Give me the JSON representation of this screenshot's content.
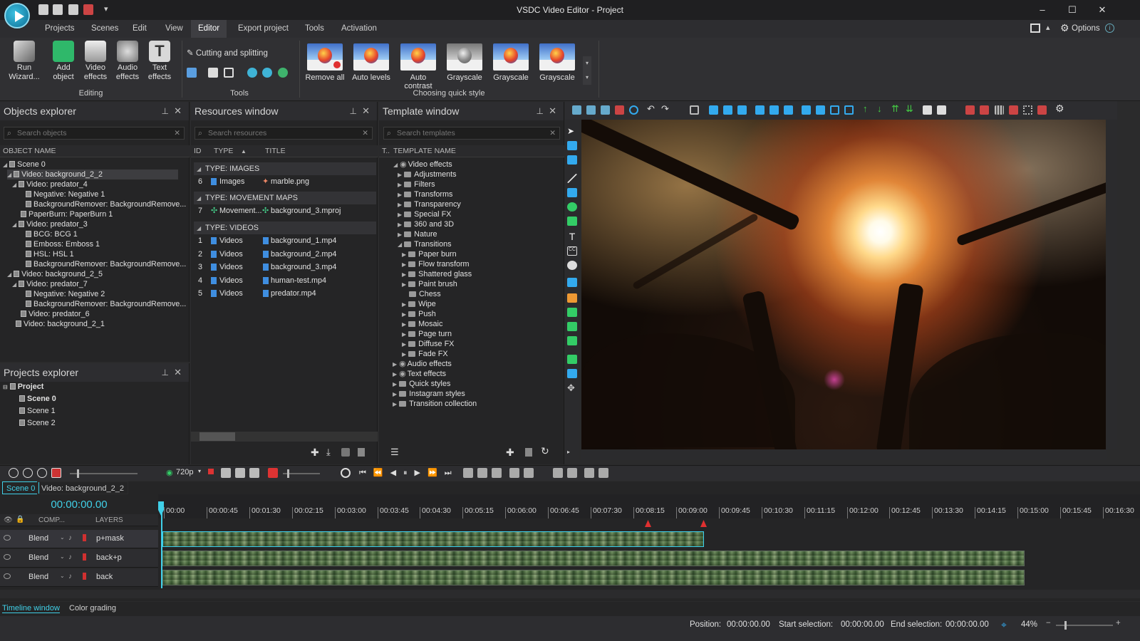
{
  "window": {
    "title": "VSDC Video Editor - Project",
    "options_label": "Options",
    "minimize": "–",
    "maximize": "☐",
    "close": "✕"
  },
  "menu": [
    "Projects",
    "Scenes",
    "Edit",
    "View",
    "Editor",
    "Export project",
    "Tools",
    "Activation"
  ],
  "ribbon": {
    "editing": {
      "run_wizard": "Run Wizard...",
      "add_object": "Add object",
      "video_effects": "Video effects",
      "audio_effects": "Audio effects",
      "text_effects": "Text effects",
      "label": "Editing"
    },
    "tools": {
      "cutting": "Cutting and splitting",
      "label": "Tools"
    },
    "quick_style": {
      "items": [
        "Remove all",
        "Auto levels",
        "Auto contrast",
        "Grayscale",
        "Grayscale",
        "Grayscale"
      ],
      "label": "Choosing quick style"
    }
  },
  "objects_explorer": {
    "title": "Objects explorer",
    "search_placeholder": "Search objects",
    "col": "OBJECT NAME",
    "items": [
      "Scene 0",
      "Video: background_2_2",
      "Video: predator_4",
      "Negative: Negative 1",
      "BackgroundRemover: BackgroundRemove...",
      "PaperBurn: PaperBurn 1",
      "Video: predator_3",
      "BCG: BCG 1",
      "Emboss: Emboss 1",
      "HSL: HSL 1",
      "BackgroundRemover: BackgroundRemove...",
      "Video: background_2_5",
      "Video: predator_7",
      "Negative: Negative 2",
      "BackgroundRemover: BackgroundRemove...",
      "Video: predator_6",
      "Video: background_2_1"
    ]
  },
  "projects_explorer": {
    "title": "Projects explorer",
    "items": [
      "Project",
      "Scene 0",
      "Scene 1",
      "Scene 2"
    ]
  },
  "resources": {
    "title": "Resources window",
    "search_placeholder": "Search resources",
    "cols": [
      "ID",
      "TYPE",
      "TITLE"
    ],
    "group_images": "TYPE: IMAGES",
    "group_maps": "TYPE: MOVEMENT MAPS",
    "group_videos": "TYPE: VIDEOS",
    "images": [
      {
        "id": "6",
        "type": "Images",
        "title": "marble.png"
      }
    ],
    "maps": [
      {
        "id": "7",
        "type": "Movement...",
        "title": "background_3.mproj"
      }
    ],
    "videos": [
      {
        "id": "1",
        "type": "Videos",
        "title": "background_1.mp4"
      },
      {
        "id": "2",
        "type": "Videos",
        "title": "background_2.mp4"
      },
      {
        "id": "3",
        "type": "Videos",
        "title": "background_3.mp4"
      },
      {
        "id": "4",
        "type": "Videos",
        "title": "human-test.mp4"
      },
      {
        "id": "5",
        "type": "Videos",
        "title": "predator.mp4"
      }
    ]
  },
  "templates": {
    "title": "Template window",
    "search_placeholder": "Search templates",
    "col_t": "T..",
    "col": "TEMPLATE NAME",
    "items": [
      "Video effects",
      "Adjustments",
      "Filters",
      "Transforms",
      "Transparency",
      "Special FX",
      "360 and 3D",
      "Nature",
      "Transitions",
      "Paper burn",
      "Flow transform",
      "Shattered glass",
      "Paint brush",
      "Chess",
      "Wipe",
      "Push",
      "Mosaic",
      "Page turn",
      "Diffuse FX",
      "Fade FX",
      "Audio effects",
      "Text effects",
      "Quick styles",
      "Instagram styles",
      "Transition collection"
    ]
  },
  "playback": {
    "resolution": "720p"
  },
  "timeline": {
    "tabs": [
      "Scene 0",
      "Video: background_2_2"
    ],
    "timecode": "00:00:00.00",
    "col_comp": "COMP...",
    "col_layers": "LAYERS",
    "ticks": [
      "00:00",
      "00:00:45",
      "00:01:30",
      "00:02:15",
      "00:03:00",
      "00:03:45",
      "00:04:30",
      "00:05:15",
      "00:06:00",
      "00:06:45",
      "00:07:30",
      "00:08:15",
      "00:09:00",
      "00:09:45",
      "00:10:30",
      "00:11:15",
      "00:12:00",
      "00:12:45",
      "00:13:30",
      "00:14:15",
      "00:15:00",
      "00:15:45",
      "00:16:30"
    ],
    "layers": [
      {
        "blend": "Blend",
        "name": "p+mask"
      },
      {
        "blend": "Blend",
        "name": "back+p"
      },
      {
        "blend": "Blend",
        "name": "back"
      }
    ]
  },
  "bottom_tabs": [
    "Timeline window",
    "Color grading"
  ],
  "status": {
    "position_label": "Position:",
    "position": "00:00:00.00",
    "start_label": "Start selection:",
    "start": "00:00:00.00",
    "end_label": "End selection:",
    "end": "00:00:00.00",
    "zoom": "44%"
  }
}
